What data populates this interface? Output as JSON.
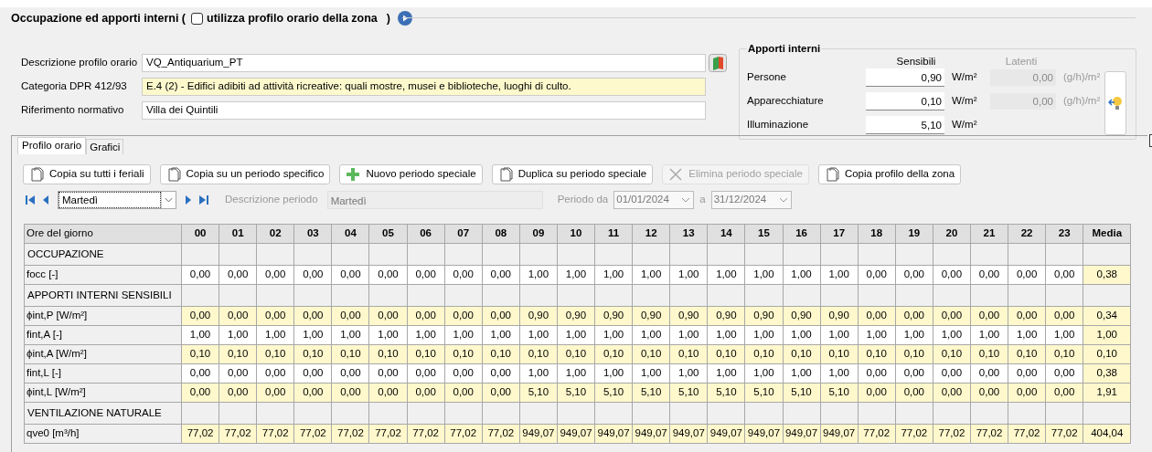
{
  "section": {
    "title": "Occupazione ed apporti interni (",
    "checkbox_label": "utilizza profilo orario della zona",
    "checked": false,
    "close_paren": ")"
  },
  "form": [
    {
      "label": "Descrizione profilo orario",
      "value": "VQ_Antiquarium_PT",
      "kind": "book"
    },
    {
      "label": "Categoria DPR 412/93",
      "value": "E.4 (2) - Edifici adibiti ad attività ricreative: quali mostre, musei e biblioteche, luoghi di culto.",
      "kind": "highlight"
    },
    {
      "label": "Riferimento normativo",
      "value": "Villa dei Quintili",
      "kind": "plain"
    }
  ],
  "apporti": {
    "title": "Apporti interni",
    "col_sensibili": "Sensibili",
    "col_latenti": "Latenti",
    "rows": [
      {
        "label": "Persone",
        "sensibile": "0,90",
        "unit": "W/m²",
        "latente": "0,00",
        "latent_unit": "(g/h)/m²"
      },
      {
        "label": "Apparecchiature",
        "sensibile": "0,10",
        "unit": "W/m²",
        "latente": "0,00",
        "latent_unit": "(g/h)/m²"
      },
      {
        "label": "Illuminazione",
        "sensibile": "5,10",
        "unit": "W/m²"
      }
    ]
  },
  "tabs": [
    {
      "label": "Profilo orario",
      "selected": true
    },
    {
      "label": "Grafici",
      "selected": false
    }
  ],
  "toolbar": [
    {
      "label": "Copia su tutti i feriali",
      "kind": "copy",
      "disabled": false
    },
    {
      "label": "Copia su un periodo specifico",
      "kind": "copy",
      "disabled": false
    },
    {
      "label": "Nuovo periodo speciale",
      "kind": "plus",
      "disabled": false
    },
    {
      "label": "Duplica su periodo speciale",
      "kind": "copy",
      "disabled": false
    },
    {
      "label": "Elimina periodo speciale",
      "kind": "x",
      "disabled": true
    },
    {
      "label": "Copia profilo della zona",
      "kind": "copy",
      "disabled": false
    }
  ],
  "period": {
    "day": "Martedì",
    "desc_label": "Descrizione periodo",
    "desc_value": "Martedì",
    "from_label": "Periodo da",
    "from": "01/01/2024",
    "to_label": "a",
    "to": "31/12/2024"
  },
  "table": {
    "columns": [
      "Ore del giorno",
      "00",
      "01",
      "02",
      "03",
      "04",
      "05",
      "06",
      "07",
      "08",
      "09",
      "10",
      "11",
      "12",
      "13",
      "14",
      "15",
      "16",
      "17",
      "18",
      "19",
      "20",
      "21",
      "22",
      "23",
      "Media"
    ],
    "rows": [
      {
        "kind": "section",
        "label": "OCCUPAZIONE"
      },
      {
        "kind": "data",
        "label": "focc [-]",
        "shaded": false,
        "values": [
          "0,00",
          "0,00",
          "0,00",
          "0,00",
          "0,00",
          "0,00",
          "0,00",
          "0,00",
          "0,00",
          "1,00",
          "1,00",
          "1,00",
          "1,00",
          "1,00",
          "1,00",
          "1,00",
          "1,00",
          "1,00",
          "0,00",
          "0,00",
          "0,00",
          "0,00",
          "0,00",
          "0,00"
        ],
        "media": "0,38"
      },
      {
        "kind": "section",
        "label": "APPORTI INTERNI SENSIBILI"
      },
      {
        "kind": "data",
        "label": "ϕint,P  [W/m²]",
        "shaded": true,
        "values": [
          "0,00",
          "0,00",
          "0,00",
          "0,00",
          "0,00",
          "0,00",
          "0,00",
          "0,00",
          "0,00",
          "0,90",
          "0,90",
          "0,90",
          "0,90",
          "0,90",
          "0,90",
          "0,90",
          "0,90",
          "0,90",
          "0,00",
          "0,00",
          "0,00",
          "0,00",
          "0,00",
          "0,00"
        ],
        "media": "0,34"
      },
      {
        "kind": "data",
        "label": "fint,A [-]",
        "shaded": false,
        "values": [
          "1,00",
          "1,00",
          "1,00",
          "1,00",
          "1,00",
          "1,00",
          "1,00",
          "1,00",
          "1,00",
          "1,00",
          "1,00",
          "1,00",
          "1,00",
          "1,00",
          "1,00",
          "1,00",
          "1,00",
          "1,00",
          "1,00",
          "1,00",
          "1,00",
          "1,00",
          "1,00",
          "1,00"
        ],
        "media": "1,00"
      },
      {
        "kind": "data",
        "label": "ϕint,A  [W/m²]",
        "shaded": true,
        "values": [
          "0,10",
          "0,10",
          "0,10",
          "0,10",
          "0,10",
          "0,10",
          "0,10",
          "0,10",
          "0,10",
          "0,10",
          "0,10",
          "0,10",
          "0,10",
          "0,10",
          "0,10",
          "0,10",
          "0,10",
          "0,10",
          "0,10",
          "0,10",
          "0,10",
          "0,10",
          "0,10",
          "0,10"
        ],
        "media": "0,10"
      },
      {
        "kind": "data",
        "label": "fint,L [-]",
        "shaded": false,
        "values": [
          "0,00",
          "0,00",
          "0,00",
          "0,00",
          "0,00",
          "0,00",
          "0,00",
          "0,00",
          "0,00",
          "1,00",
          "1,00",
          "1,00",
          "1,00",
          "1,00",
          "1,00",
          "1,00",
          "1,00",
          "1,00",
          "0,00",
          "0,00",
          "0,00",
          "0,00",
          "0,00",
          "0,00"
        ],
        "media": "0,38"
      },
      {
        "kind": "data",
        "label": "ϕint,L  [W/m²]",
        "shaded": true,
        "values": [
          "0,00",
          "0,00",
          "0,00",
          "0,00",
          "0,00",
          "0,00",
          "0,00",
          "0,00",
          "0,00",
          "5,10",
          "5,10",
          "5,10",
          "5,10",
          "5,10",
          "5,10",
          "5,10",
          "5,10",
          "5,10",
          "0,00",
          "0,00",
          "0,00",
          "0,00",
          "0,00",
          "0,00"
        ],
        "media": "1,91"
      },
      {
        "kind": "section",
        "label": "VENTILAZIONE NATURALE"
      },
      {
        "kind": "data",
        "label": "qve0 [m³/h]",
        "shaded": true,
        "values": [
          "77,02",
          "77,02",
          "77,02",
          "77,02",
          "77,02",
          "77,02",
          "77,02",
          "77,02",
          "77,02",
          "949,07",
          "949,07",
          "949,07",
          "949,07",
          "949,07",
          "949,07",
          "949,07",
          "949,07",
          "949,07",
          "77,02",
          "77,02",
          "77,02",
          "77,02",
          "77,02",
          "77,02"
        ],
        "media": "404,04"
      }
    ]
  }
}
